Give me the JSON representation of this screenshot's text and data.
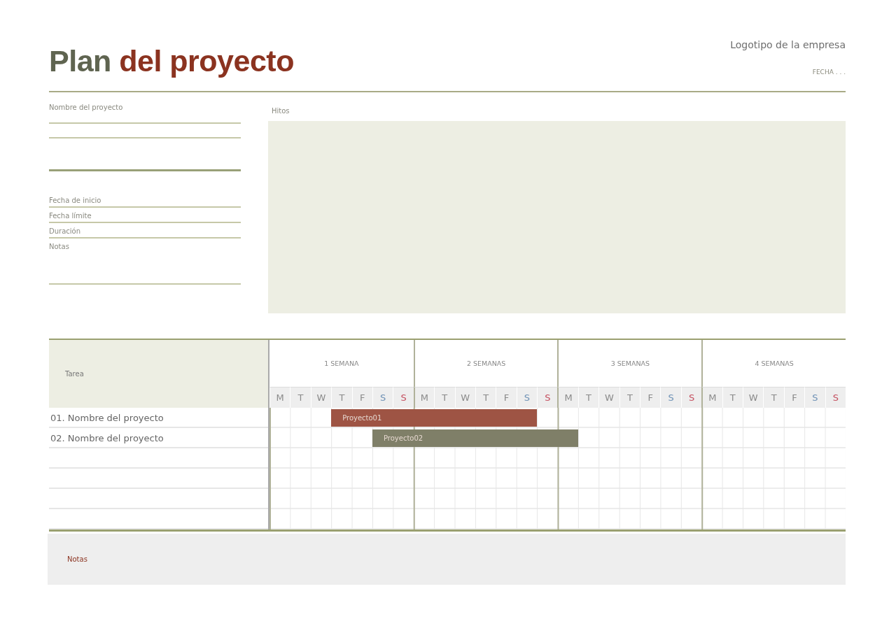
{
  "header": {
    "title": [
      {
        "text": "Plan",
        "color": "#5f6450"
      },
      {
        "text": "del proyecto",
        "color": "#8b3320"
      }
    ],
    "logo": "Logotipo de la empresa",
    "date": "FECHA . . ."
  },
  "project_form": {
    "name_label": "Nombre del proyecto",
    "fields": [
      {
        "label": "Fecha de inicio"
      },
      {
        "label": "Fecha límite"
      },
      {
        "label": "Duración"
      },
      {
        "label": "Notas"
      }
    ]
  },
  "milestones": {
    "label": "Hitos"
  },
  "gantt": {
    "task_heading": "Tarea",
    "weeks": [
      {
        "label": "1 SEMANA",
        "days": [
          {
            "letter": "M",
            "kind": "weekday"
          },
          {
            "letter": "T",
            "kind": "weekday"
          },
          {
            "letter": "W",
            "kind": "weekday"
          },
          {
            "letter": "T",
            "kind": "weekday"
          },
          {
            "letter": "F",
            "kind": "weekday"
          },
          {
            "letter": "S",
            "kind": "saturday"
          },
          {
            "letter": "S",
            "kind": "sunday"
          }
        ]
      },
      {
        "label": "2 SEMANAS",
        "days": [
          {
            "letter": "M",
            "kind": "weekday"
          },
          {
            "letter": "T",
            "kind": "weekday"
          },
          {
            "letter": "W",
            "kind": "weekday"
          },
          {
            "letter": "T",
            "kind": "weekday"
          },
          {
            "letter": "F",
            "kind": "weekday"
          },
          {
            "letter": "S",
            "kind": "saturday"
          },
          {
            "letter": "S",
            "kind": "sunday"
          }
        ]
      },
      {
        "label": "3 SEMANAS",
        "days": [
          {
            "letter": "M",
            "kind": "weekday"
          },
          {
            "letter": "T",
            "kind": "weekday"
          },
          {
            "letter": "W",
            "kind": "weekday"
          },
          {
            "letter": "T",
            "kind": "weekday"
          },
          {
            "letter": "F",
            "kind": "weekday"
          },
          {
            "letter": "S",
            "kind": "saturday"
          },
          {
            "letter": "S",
            "kind": "sunday"
          }
        ]
      },
      {
        "label": "4 SEMANAS",
        "days": [
          {
            "letter": "M",
            "kind": "weekday"
          },
          {
            "letter": "T",
            "kind": "weekday"
          },
          {
            "letter": "W",
            "kind": "weekday"
          },
          {
            "letter": "T",
            "kind": "weekday"
          },
          {
            "letter": "F",
            "kind": "weekday"
          },
          {
            "letter": "S",
            "kind": "saturday"
          },
          {
            "letter": "S",
            "kind": "sunday"
          }
        ]
      }
    ],
    "tasks": [
      {
        "name": "01. Nombre del proyecto",
        "bar": {
          "label": "Proyecto01",
          "color": "#9e5444",
          "start": {
            "level": 0.1071
          },
          "end": {
            "level": 0.4643
          }
        }
      },
      {
        "name": "02. Nombre del proyecto",
        "bar": {
          "label": "Proyecto02",
          "color": "#7f7f68",
          "start": {
            "level": 0.1786
          },
          "end": {
            "level": 0.5357
          }
        }
      }
    ]
  },
  "notes": {
    "label": "Notas"
  }
}
